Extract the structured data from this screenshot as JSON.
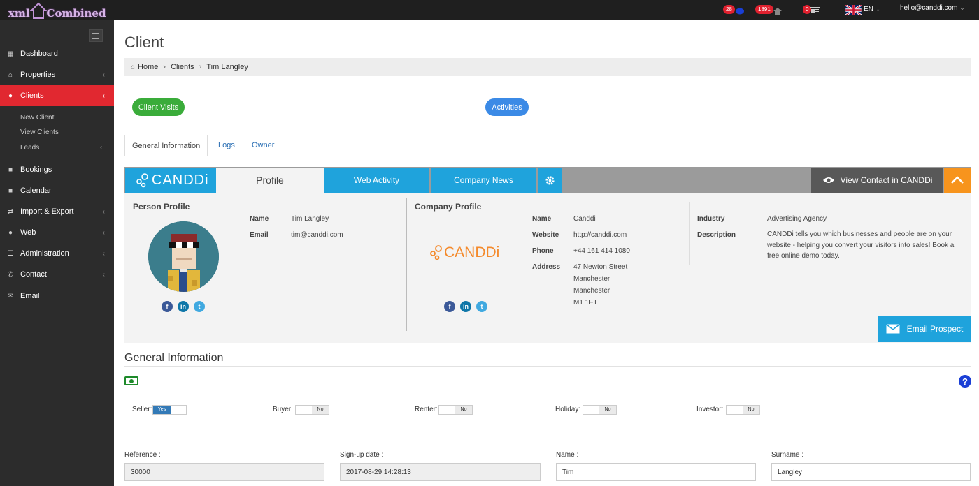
{
  "topbar": {
    "logo_left": "xml",
    "logo_right": "Combined",
    "badges": {
      "messages": "28",
      "properties": "1891",
      "news": "0"
    },
    "language": "EN",
    "user_email": "hello@canddi.com"
  },
  "sidebar": {
    "items": [
      {
        "label": "Dashboard",
        "icon": "grid-icon"
      },
      {
        "label": "Properties",
        "icon": "home-icon"
      },
      {
        "label": "Clients",
        "icon": "users-icon",
        "active": true
      },
      {
        "label": "Bookings",
        "icon": "lock-icon"
      },
      {
        "label": "Calendar",
        "icon": "lock-icon"
      },
      {
        "label": "Import & Export",
        "icon": "exchange-icon"
      },
      {
        "label": "Web",
        "icon": "globe-icon"
      },
      {
        "label": "Administration",
        "icon": "list-icon"
      },
      {
        "label": "Contact",
        "icon": "phone-icon"
      },
      {
        "label": "Email",
        "icon": "envelope-icon"
      }
    ],
    "subitems": [
      "New Client",
      "View Clients",
      "Leads"
    ]
  },
  "page": {
    "title": "Client",
    "breadcrumb": [
      "Home",
      "Clients",
      "Tim Langley"
    ]
  },
  "actions": {
    "client_visits": "Client Visits",
    "activities": "Activities"
  },
  "tabs": [
    "General Information",
    "Logs",
    "Owner"
  ],
  "candi": {
    "logo": "CANDDi",
    "tabs": {
      "profile": "Profile",
      "web_activity": "Web Activity",
      "company_news": "Company News"
    },
    "view_contact": "View Contact in CANDDi",
    "person": {
      "heading": "Person Profile",
      "name_label": "Name",
      "name": "Tim Langley",
      "email_label": "Email",
      "email": "tim@canddi.com"
    },
    "company": {
      "heading": "Company Profile",
      "logo": "CANDDi",
      "name_label": "Name",
      "name": "Canddi",
      "website_label": "Website",
      "website": "http://canddi.com",
      "phone_label": "Phone",
      "phone": "+44 161 414 1080",
      "address_label": "Address",
      "address": [
        "47 Newton Street",
        "Manchester",
        "Manchester",
        "M1 1FT"
      ],
      "industry_label": "Industry",
      "industry": "Advertising Agency",
      "description_label": "Description",
      "description": "CANDDi tells you which businesses and people are on your website - helping you convert your visitors into sales! Book a free online demo today."
    },
    "email_prospect": "Email Prospect"
  },
  "general_info": {
    "title": "General Information",
    "toggles": [
      {
        "label": "Seller:",
        "state": "Yes"
      },
      {
        "label": "Buyer:",
        "state": "No"
      },
      {
        "label": "Renter:",
        "state": "No"
      },
      {
        "label": "Holiday:",
        "state": "No"
      },
      {
        "label": "Investor:",
        "state": "No"
      }
    ],
    "toggle_yes": "Yes",
    "toggle_no": "No",
    "fields": [
      {
        "label": "Reference :",
        "value": "30000"
      },
      {
        "label": "Sign-up date :",
        "value": "2017-08-29 14:28:13"
      },
      {
        "label": "Name :",
        "value": "Tim"
      },
      {
        "label": "Surname :",
        "value": "Langley"
      }
    ]
  },
  "colors": {
    "sidebar": "#2c2c2c",
    "active": "#e12830",
    "candi_blue": "#1fa3dc",
    "orange": "#f7941d",
    "green": "#3aac3a",
    "blue": "#3b8ae6"
  }
}
